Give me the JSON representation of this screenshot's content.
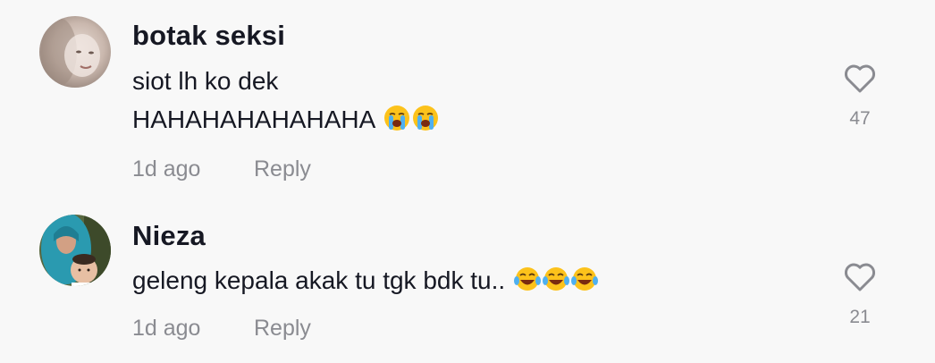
{
  "comments": [
    {
      "username": "botak seksi",
      "lines": [
        "siot lh ko dek",
        "HAHAHAHAHAHAHA"
      ],
      "emoji": [
        "loudly-crying-face",
        "loudly-crying-face"
      ],
      "time": "1d ago",
      "reply_label": "Reply",
      "likes": "47"
    },
    {
      "username": "Nieza",
      "lines": [
        "geleng kepala akak tu tgk bdk tu.."
      ],
      "emoji": [
        "face-with-tears-of-joy",
        "face-with-tears-of-joy",
        "face-with-tears-of-joy"
      ],
      "time": "1d ago",
      "reply_label": "Reply",
      "likes": "21"
    }
  ],
  "colors": {
    "background": "#f8f8f8",
    "primary_text": "#161823",
    "secondary_text": "#8a8b91"
  }
}
